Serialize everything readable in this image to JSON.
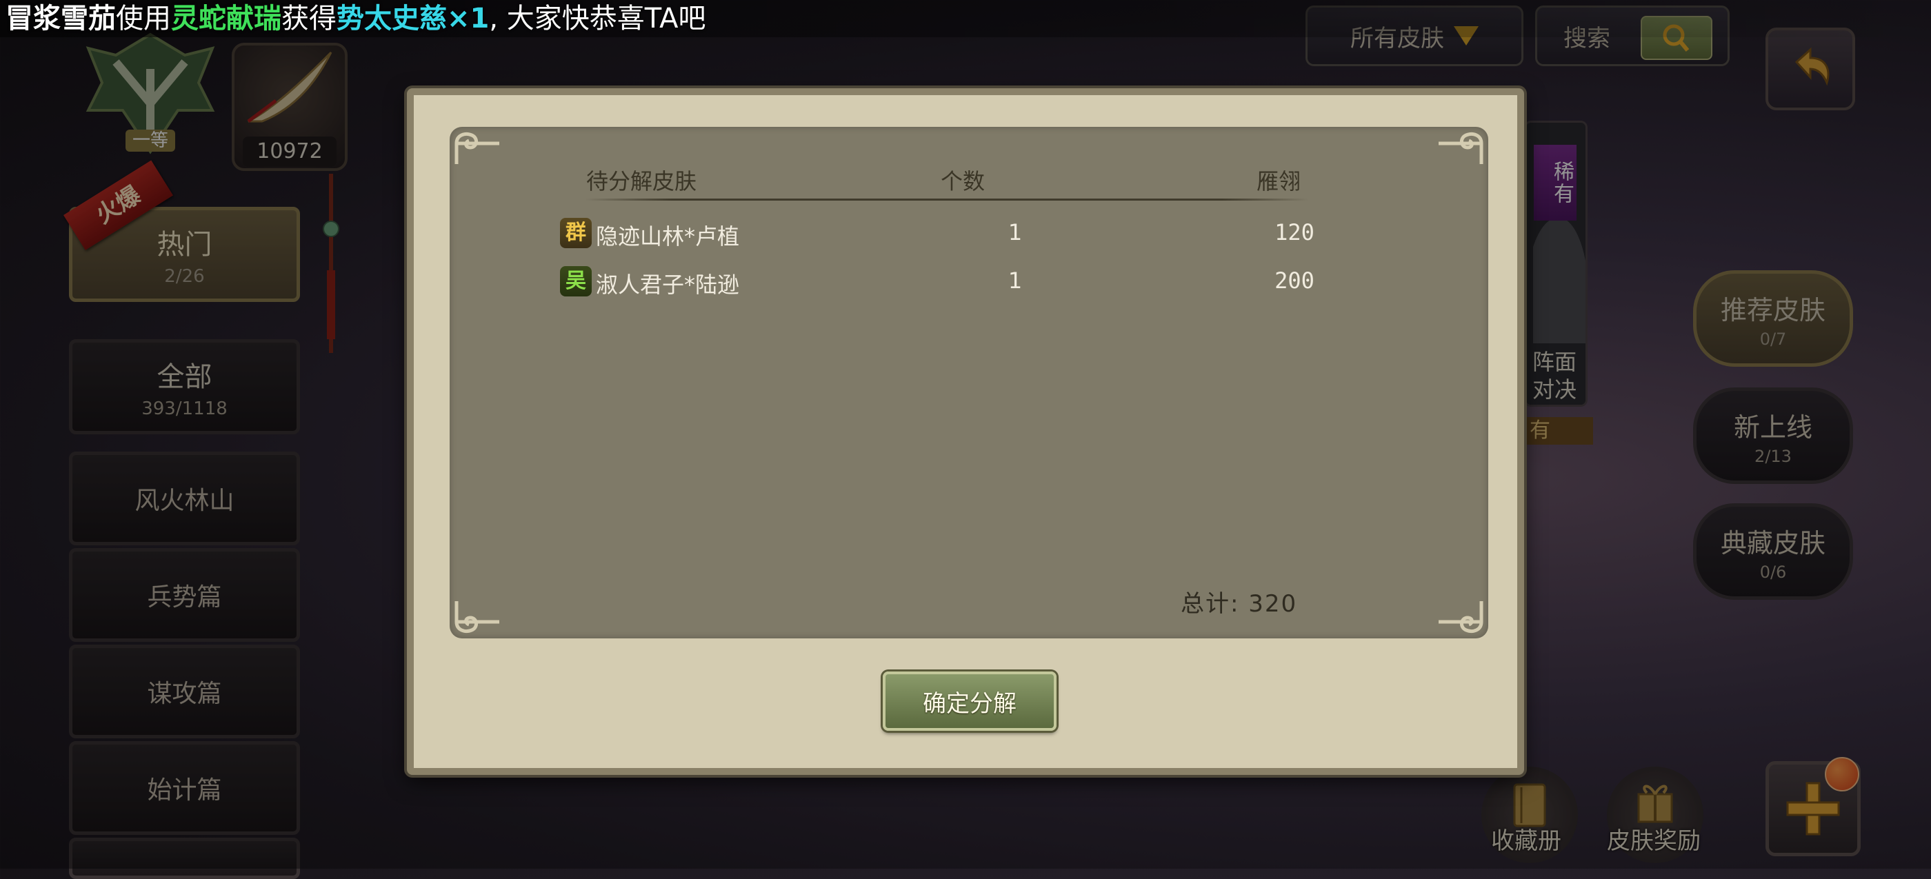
{
  "ticker": {
    "player": "冒浆雪茄",
    "verb1": "使用",
    "item1": "灵蛇献瑞",
    "verb2": "获得",
    "item2": "势太史慈×1",
    "suffix": ", 大家快恭喜TA吧"
  },
  "top_bar": {
    "filter_label": "所有皮肤",
    "search_placeholder": "搜索"
  },
  "player": {
    "rank_label": "一等",
    "currency_value": "10972"
  },
  "sidebar": {
    "hot_ribbon": "火爆",
    "items": [
      {
        "label": "热门",
        "count": "2/26"
      },
      {
        "label": "全部",
        "count": "393/1118"
      },
      {
        "label": "风火林山",
        "count": ""
      },
      {
        "label": "兵势篇",
        "count": ""
      },
      {
        "label": "谋攻篇",
        "count": ""
      },
      {
        "label": "始计篇",
        "count": ""
      }
    ]
  },
  "right_tabs": [
    {
      "label": "推荐皮肤",
      "count": "0/7"
    },
    {
      "label": "新上线",
      "count": "2/13"
    },
    {
      "label": "典藏皮肤",
      "count": "0/6"
    }
  ],
  "card": {
    "rarity": "稀有",
    "caption_line1": "阵面",
    "caption_line2": "对决",
    "owned": "有"
  },
  "bottom_buttons": {
    "collection": "收藏册",
    "skin_rewards": "皮肤奖励"
  },
  "modal": {
    "columns": {
      "skin": "待分解皮肤",
      "count": "个数",
      "value": "雁翎"
    },
    "rows": [
      {
        "faction": "群",
        "name": "隐迹山林*卢植",
        "count": "1",
        "value": "120"
      },
      {
        "faction": "吴",
        "name": "淑人君子*陆逊",
        "count": "1",
        "value": "200"
      }
    ],
    "total": "总计: 320",
    "confirm_label": "确定分解"
  }
}
